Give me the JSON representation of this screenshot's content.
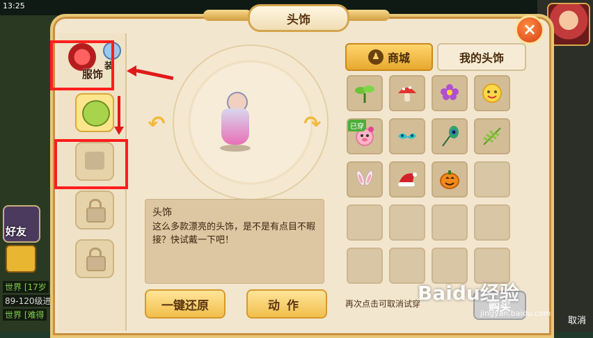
{
  "status": {
    "time": "13:25"
  },
  "background": {
    "friend_label": "好友",
    "chat_lines": [
      "世界 [17岁",
      "89-120级进",
      "世界 [难得"
    ],
    "cancel_label": "取消"
  },
  "dialog": {
    "title": "头饰",
    "close_label": "×"
  },
  "left_tabs": {
    "costume_label_a": "装",
    "costume_label_b": "服饰"
  },
  "description": {
    "title": "头饰",
    "text": "这么多款漂亮的头饰，是不是有点目不暇接？快试戴一下吧！"
  },
  "buttons": {
    "reset": "一键还原",
    "action": "动作",
    "buy": "购买",
    "hint": "再次点击可取消试穿"
  },
  "right_tabs": {
    "shop": "商城",
    "mine": "我的头饰"
  },
  "items": [
    {
      "name": "sprout",
      "icon": "sprout-icon"
    },
    {
      "name": "mushroom",
      "icon": "mushroom-icon"
    },
    {
      "name": "flower",
      "icon": "flower-icon"
    },
    {
      "name": "smiley",
      "icon": "smiley-icon"
    },
    {
      "name": "pig-face",
      "icon": "pig-face-icon",
      "badge": "已穿"
    },
    {
      "name": "mask",
      "icon": "mask-icon"
    },
    {
      "name": "peacock-feather",
      "icon": "feather-icon"
    },
    {
      "name": "leaf",
      "icon": "leaf-icon"
    },
    {
      "name": "bunny-ears",
      "icon": "bunny-ears-icon"
    },
    {
      "name": "santa-hat",
      "icon": "santa-hat-icon"
    },
    {
      "name": "pumpkin",
      "icon": "pumpkin-icon"
    }
  ],
  "watermark": {
    "text": "Baidu经验",
    "sub": "jingyan.baidu.com"
  },
  "colors": {
    "accent": "#f1bf4a",
    "panel": "#f3e6cf",
    "highlight": "#ff1e1e"
  }
}
